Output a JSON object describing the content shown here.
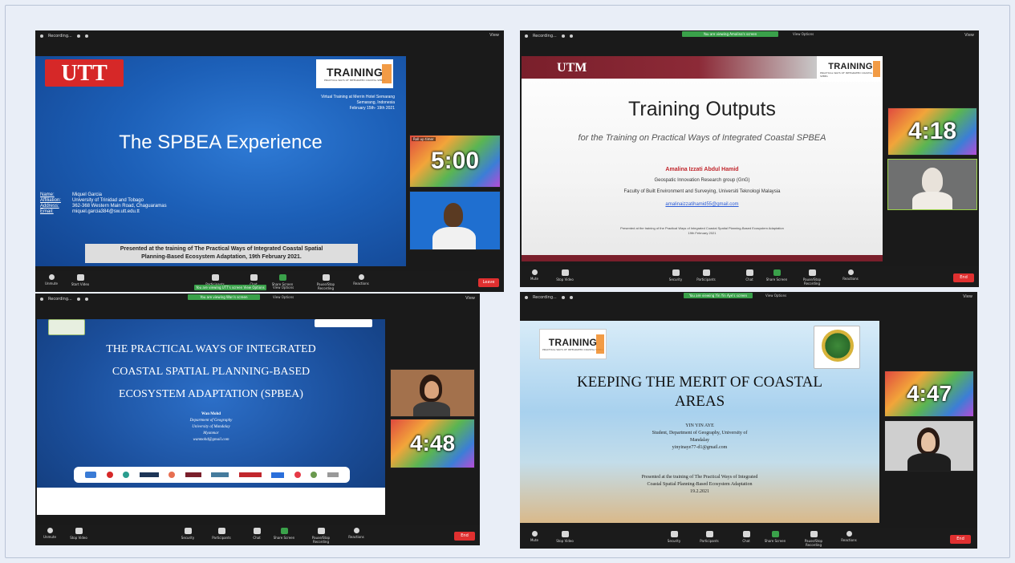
{
  "panels": {
    "p1": {
      "recording_label": "Recording...",
      "view_label": "View",
      "green_banner": "You are viewing UTT's screen  View Options",
      "view_options": "View Options",
      "org_logo": "UTT",
      "training_logo_word": "TRAINING",
      "training_logo_sub": "PRACTICAL WAYS OF INTEGRATED COASTAL SPBEA",
      "event_line1": "Virtual Training at Merrin Hotel Semarang",
      "event_line2": "Semarang, Indonesia",
      "event_line3": "February 15th- 19th 2021",
      "title": "The SPBEA Experience",
      "info_labels": [
        "Name:",
        "Affiliation:",
        "Address:",
        "Email:"
      ],
      "info_values": [
        "Miquel Garcia",
        "University of Trinidad and Tobago",
        "362-368 Western Main Road, Chaguaramas",
        "miquel.garcia384@sw.utt.edu.tt"
      ],
      "footer_line1": "Presented at the training of The Practical Ways of Integrated Coastal Spatial",
      "footer_line2": "Planning-Based Ecosystem Adaptation, 19th February 2021.",
      "timer": "5:00",
      "timer_caption": "Roll up timer",
      "toolbar": [
        "Unmute",
        "Start Video",
        "Participants",
        "Chat",
        "Share Screen",
        "Pause/Stop Recording",
        "Reactions"
      ],
      "end_label": "Leave"
    },
    "p2": {
      "recording_label": "Recording...",
      "view_label": "View",
      "green_banner": "You are viewing Amalina's screen",
      "view_options": "View Options",
      "org_logo": "UTM",
      "training_logo_word": "TRAINING",
      "training_logo_sub": "PRACTICAL WAYS OF INTEGRATED COASTAL SPBEA",
      "title": "Training Outputs",
      "subtitle": "for the Training on Practical Ways of Integrated Coastal SPBEA",
      "presenter": "Amalina Izzati Abdul Hamid",
      "affil1": "Geospatic Innovation Research group (GnG)",
      "affil2": "Faculty of Built Environment and Surveying, Universiti Teknologi Malaysia",
      "email": "amalinaizzatihamid55@gmail.com",
      "foot1": "Presented at the training of the Practical Ways of Integrated Coastal Spatial Planning-Based Ecosystem Adaptation",
      "foot2": "19th February 2021",
      "timer": "4:18",
      "toolbar": [
        "Mute",
        "Stop Video",
        "Security",
        "Participants",
        "Chat",
        "Share Screen",
        "Pause/Stop Recording",
        "Reactions"
      ],
      "end_label": "End"
    },
    "p3": {
      "recording_label": "Recording...",
      "view_label": "View",
      "green_banner": "You are viewing Wan's screen",
      "view_options": "View Options",
      "title_line1": "THE PRACTICAL WAYS OF INTEGRATED",
      "title_line2": "COASTAL SPATIAL PLANNING-BASED",
      "title_line3": "ECOSYSTEM ADAPTATION (SPBEA)",
      "info1": "Wan Mohd",
      "info2": "Department of Geography",
      "info3": "University of Mandalay",
      "info4": "Myanmar",
      "info5": "wanmohd@gmail.com",
      "timer": "4:48",
      "toolbar": [
        "Unmute",
        "Stop Video",
        "Security",
        "Participants",
        "Chat",
        "Share Screen",
        "Pause/Stop Recording",
        "Reactions"
      ],
      "end_label": "End"
    },
    "p4": {
      "recording_label": "Recording...",
      "view_label": "View",
      "green_banner": "You are viewing Yin Yin Aye's screen",
      "view_options": "View Options",
      "training_logo_word": "TRAINING",
      "training_logo_sub": "PRACTICAL WAYS OF INTEGRATED COASTAL SPBEA",
      "title_line1": "KEEPING THE MERIT OF COASTAL",
      "title_line2": "AREAS",
      "author": "YIN YIN AYE",
      "author_affil1": "Student, Department of Geography, University of",
      "author_affil2": "Mandalay",
      "author_email": "yinyinaye77-d1@gmail.com",
      "foot1": "Presented at the training of The Practical Ways of Integrated",
      "foot2": "Coastal Spatial Planning-Based Ecosystem Adaptation",
      "foot3": "19.2.2021",
      "timer": "4:47",
      "toolbar": [
        "Mute",
        "Stop Video",
        "Security",
        "Participants",
        "Chat",
        "Share Screen",
        "Pause/Stop Recording",
        "Reactions"
      ],
      "end_label": "End"
    }
  },
  "colors": {
    "zoom_bg": "#1a1a1a",
    "green": "#3aa14a",
    "end_red": "#e03030",
    "utt_red": "#d62828",
    "utm_maroon": "#7a1f2b"
  }
}
